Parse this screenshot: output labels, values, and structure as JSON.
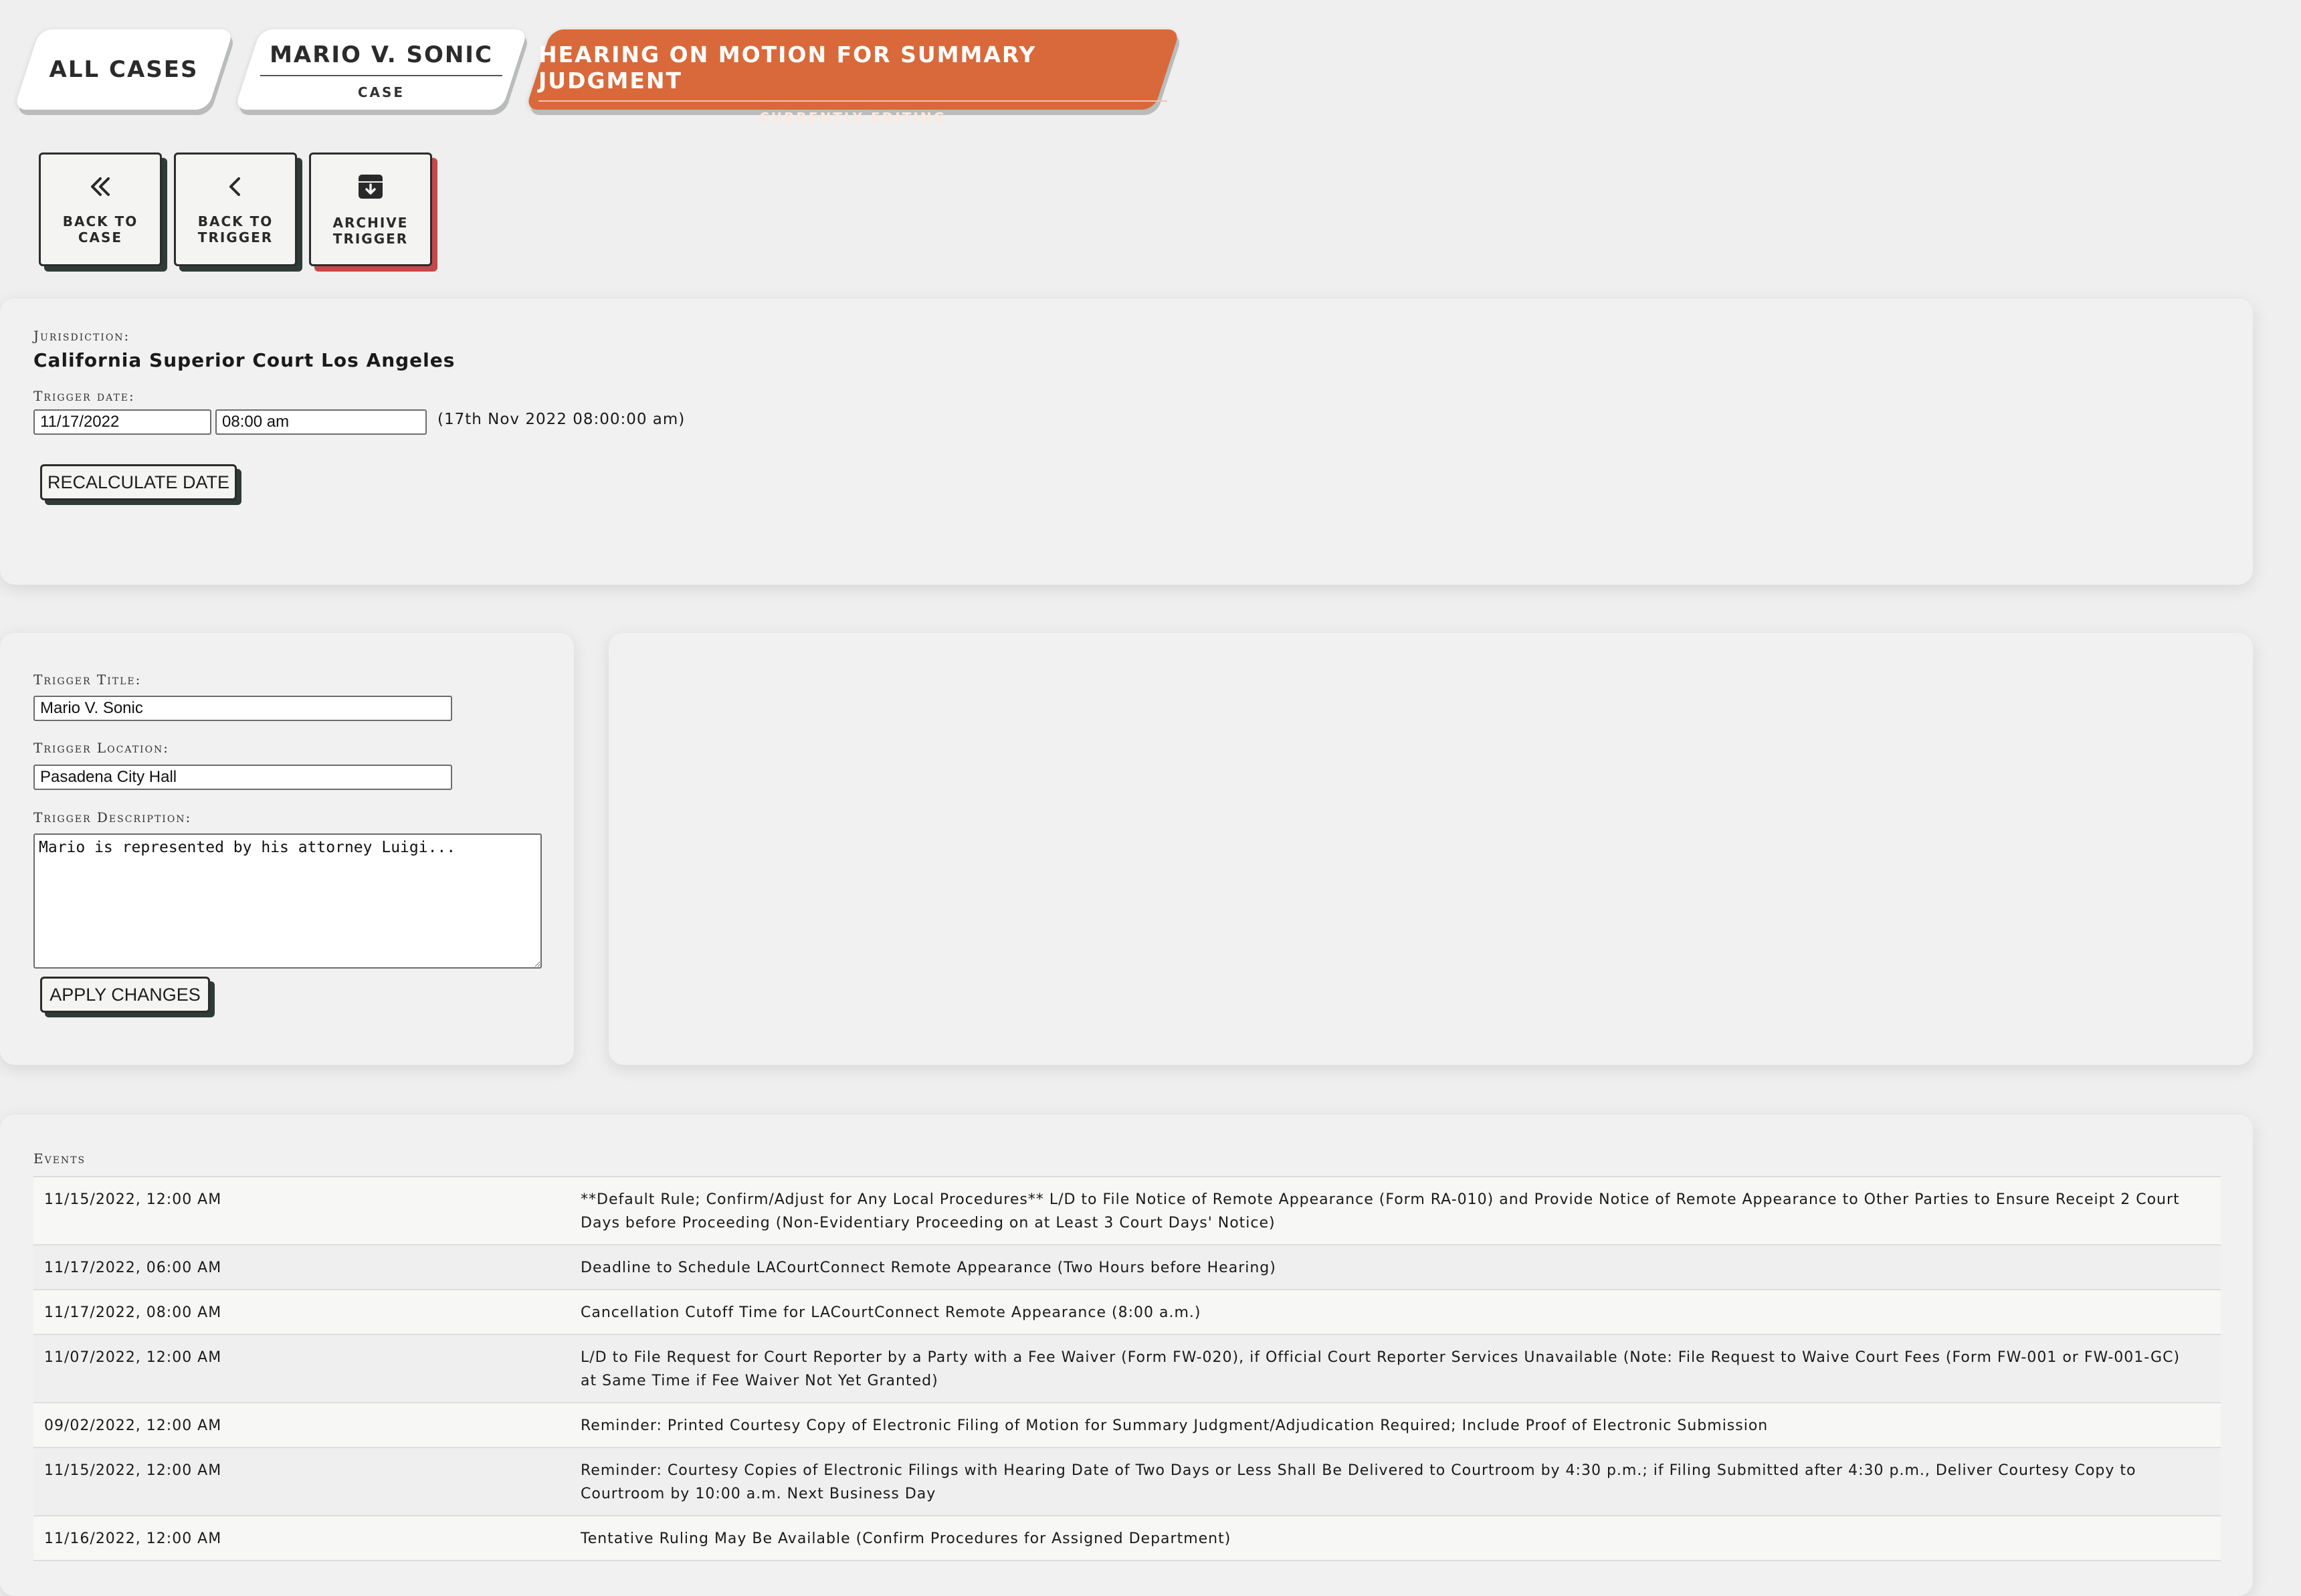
{
  "breadcrumbs": {
    "all_cases": "ALL CASES",
    "case_title": "MARIO V. SONIC",
    "case_sub": "CASE",
    "current_title": "HEARING ON MOTION FOR SUMMARY JUDGMENT",
    "current_sub": "CURRENTLY EDITING"
  },
  "actions": {
    "back_to_case": "BACK TO CASE",
    "back_to_trigger": "BACK TO TRIGGER",
    "archive_trigger": "ARCHIVE TRIGGER"
  },
  "jurisdiction": {
    "label": "Jurisdiction:",
    "value": "California Superior Court Los Angeles",
    "trigger_date_label": "Trigger date:",
    "date_value": "11/17/2022",
    "time_value": "08:00 am",
    "date_note": "(17th Nov 2022 08:00:00 am)",
    "recalculate_label": "RECALCULATE DATE"
  },
  "trigger": {
    "title_label": "Trigger Title:",
    "title_value": "Mario V. Sonic",
    "location_label": "Trigger Location:",
    "location_value": "Pasadena City Hall",
    "description_label": "Trigger Description:",
    "description_value": "Mario is represented by his attorney Luigi...",
    "apply_label": "APPLY CHANGES"
  },
  "events": {
    "label": "Events",
    "rows": [
      {
        "date": "11/15/2022, 12:00 AM",
        "desc": "**Default Rule; Confirm/Adjust for Any Local Procedures** L/D to File Notice of Remote Appearance (Form RA-010) and Provide Notice of Remote Appearance to Other Parties to Ensure Receipt 2 Court Days before Proceeding (Non-Evidentiary Proceeding on at Least 3 Court Days' Notice)"
      },
      {
        "date": "11/17/2022, 06:00 AM",
        "desc": "Deadline to Schedule LACourtConnect Remote Appearance (Two Hours before Hearing)"
      },
      {
        "date": "11/17/2022, 08:00 AM",
        "desc": "Cancellation Cutoff Time for LACourtConnect Remote Appearance (8:00 a.m.)"
      },
      {
        "date": "11/07/2022, 12:00 AM",
        "desc": "L/D to File Request for Court Reporter by a Party with a Fee Waiver (Form FW-020), if Official Court Reporter Services Unavailable (Note: File Request to Waive Court Fees (Form FW-001 or FW-001-GC) at Same Time if Fee Waiver Not Yet Granted)"
      },
      {
        "date": "09/02/2022, 12:00 AM",
        "desc": "Reminder: Printed Courtesy Copy of Electronic Filing of Motion for Summary Judgment/Adjudication Required; Include Proof of Electronic Submission"
      },
      {
        "date": "11/15/2022, 12:00 AM",
        "desc": "Reminder: Courtesy Copies of Electronic Filings with Hearing Date of Two Days or Less Shall Be Delivered to Courtroom by 4:30 p.m.; if Filing Submitted after 4:30 p.m., Deliver Courtesy Copy to Courtroom by 10:00 a.m. Next Business Day"
      },
      {
        "date": "11/16/2022, 12:00 AM",
        "desc": "Tentative Ruling May Be Available (Confirm Procedures for Assigned Department)"
      }
    ]
  },
  "colors": {
    "accent": "#d9693a",
    "danger_shadow": "#c6494a",
    "button_shadow": "#2f3b36",
    "background": "#eeefee"
  }
}
